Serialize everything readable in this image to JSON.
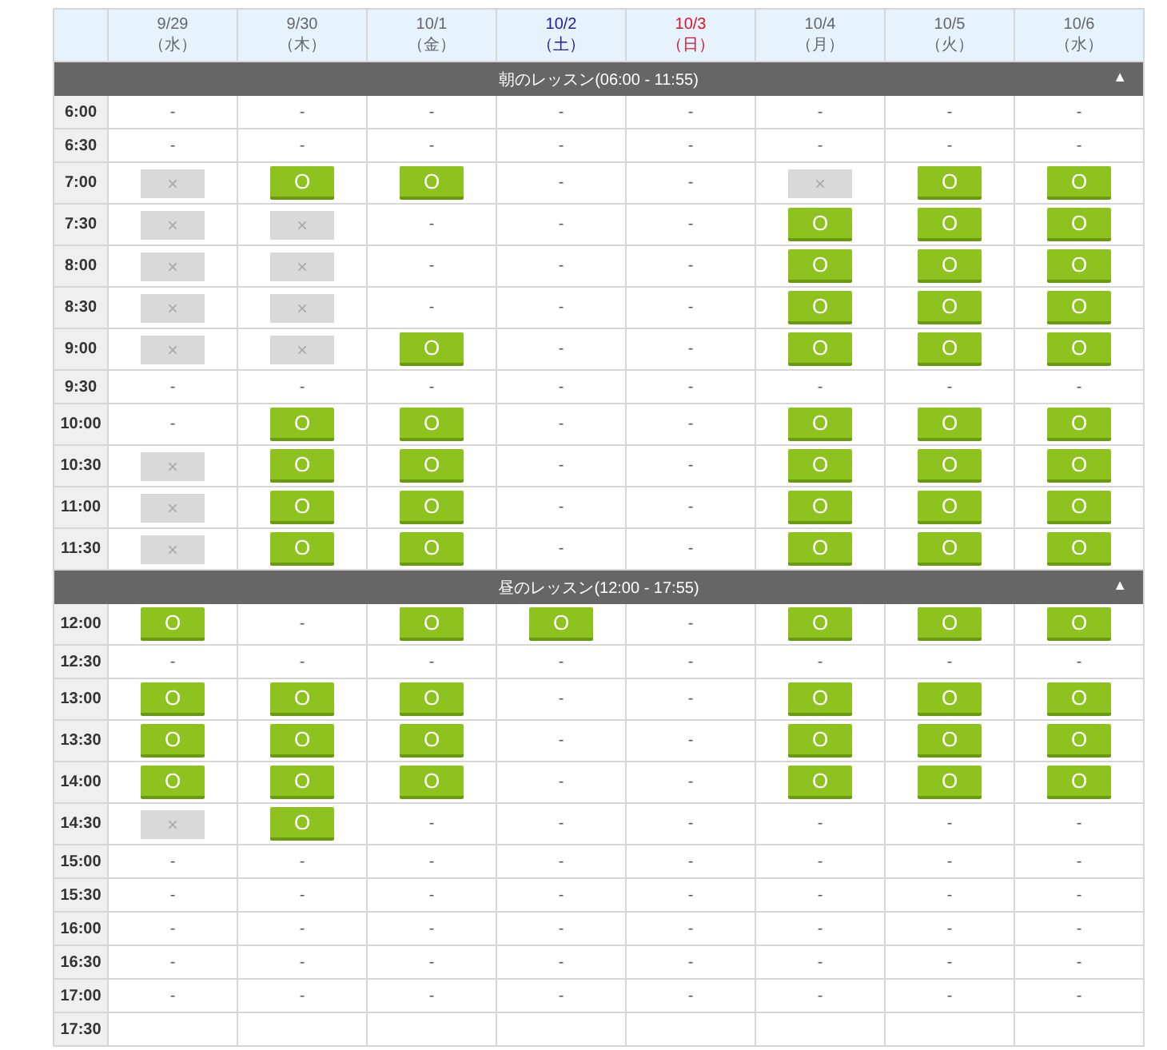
{
  "days": [
    {
      "date": "9/29",
      "weekday": "（水）",
      "color": "#666666"
    },
    {
      "date": "9/30",
      "weekday": "（木）",
      "color": "#666666"
    },
    {
      "date": "10/1",
      "weekday": "（金）",
      "color": "#666666"
    },
    {
      "date": "10/2",
      "weekday": "（土）",
      "color": "#1a1aa6"
    },
    {
      "date": "10/3",
      "weekday": "（日）",
      "color": "#e0102a"
    },
    {
      "date": "10/4",
      "weekday": "（月）",
      "color": "#666666"
    },
    {
      "date": "10/5",
      "weekday": "（火）",
      "color": "#666666"
    },
    {
      "date": "10/6",
      "weekday": "（水）",
      "color": "#666666"
    }
  ],
  "sections": [
    {
      "title": "朝のレッスン(06:00 - 11:55)",
      "toggle": "▲",
      "rows": [
        {
          "time": "6:00",
          "cells": [
            {
              "kind": "none",
              "text": "-"
            },
            {
              "kind": "none",
              "text": "-"
            },
            {
              "kind": "none",
              "text": "-"
            },
            {
              "kind": "none",
              "text": "-"
            },
            {
              "kind": "none",
              "text": "-"
            },
            {
              "kind": "none",
              "text": "-"
            },
            {
              "kind": "none",
              "text": "-"
            },
            {
              "kind": "none",
              "text": "-"
            }
          ]
        },
        {
          "time": "6:30",
          "cells": [
            {
              "kind": "none",
              "text": "-"
            },
            {
              "kind": "none",
              "text": "-"
            },
            {
              "kind": "none",
              "text": "-"
            },
            {
              "kind": "none",
              "text": "-"
            },
            {
              "kind": "none",
              "text": "-"
            },
            {
              "kind": "none",
              "text": "-"
            },
            {
              "kind": "none",
              "text": "-"
            },
            {
              "kind": "none",
              "text": "-"
            }
          ]
        },
        {
          "time": "7:00",
          "cells": [
            {
              "kind": "closed",
              "text": "×"
            },
            {
              "kind": "open",
              "text": "O"
            },
            {
              "kind": "open",
              "text": "O"
            },
            {
              "kind": "none",
              "text": "-"
            },
            {
              "kind": "none",
              "text": "-"
            },
            {
              "kind": "closed",
              "text": "×"
            },
            {
              "kind": "open",
              "text": "O"
            },
            {
              "kind": "open",
              "text": "O"
            }
          ]
        },
        {
          "time": "7:30",
          "cells": [
            {
              "kind": "closed",
              "text": "×"
            },
            {
              "kind": "closed",
              "text": "×"
            },
            {
              "kind": "none",
              "text": "-"
            },
            {
              "kind": "none",
              "text": "-"
            },
            {
              "kind": "none",
              "text": "-"
            },
            {
              "kind": "open",
              "text": "O"
            },
            {
              "kind": "open",
              "text": "O"
            },
            {
              "kind": "open",
              "text": "O"
            }
          ]
        },
        {
          "time": "8:00",
          "cells": [
            {
              "kind": "closed",
              "text": "×"
            },
            {
              "kind": "closed",
              "text": "×"
            },
            {
              "kind": "none",
              "text": "-"
            },
            {
              "kind": "none",
              "text": "-"
            },
            {
              "kind": "none",
              "text": "-"
            },
            {
              "kind": "open",
              "text": "O"
            },
            {
              "kind": "open",
              "text": "O"
            },
            {
              "kind": "open",
              "text": "O"
            }
          ]
        },
        {
          "time": "8:30",
          "cells": [
            {
              "kind": "closed",
              "text": "×"
            },
            {
              "kind": "closed",
              "text": "×"
            },
            {
              "kind": "none",
              "text": "-"
            },
            {
              "kind": "none",
              "text": "-"
            },
            {
              "kind": "none",
              "text": "-"
            },
            {
              "kind": "open",
              "text": "O"
            },
            {
              "kind": "open",
              "text": "O"
            },
            {
              "kind": "open",
              "text": "O"
            }
          ]
        },
        {
          "time": "9:00",
          "cells": [
            {
              "kind": "closed",
              "text": "×"
            },
            {
              "kind": "closed",
              "text": "×"
            },
            {
              "kind": "open",
              "text": "O"
            },
            {
              "kind": "none",
              "text": "-"
            },
            {
              "kind": "none",
              "text": "-"
            },
            {
              "kind": "open",
              "text": "O"
            },
            {
              "kind": "open",
              "text": "O"
            },
            {
              "kind": "open",
              "text": "O"
            }
          ]
        },
        {
          "time": "9:30",
          "cells": [
            {
              "kind": "none",
              "text": "-"
            },
            {
              "kind": "none",
              "text": "-"
            },
            {
              "kind": "none",
              "text": "-"
            },
            {
              "kind": "none",
              "text": "-"
            },
            {
              "kind": "none",
              "text": "-"
            },
            {
              "kind": "none",
              "text": "-"
            },
            {
              "kind": "none",
              "text": "-"
            },
            {
              "kind": "none",
              "text": "-"
            }
          ]
        },
        {
          "time": "10:00",
          "cells": [
            {
              "kind": "none",
              "text": "-"
            },
            {
              "kind": "open",
              "text": "O"
            },
            {
              "kind": "open",
              "text": "O"
            },
            {
              "kind": "none",
              "text": "-"
            },
            {
              "kind": "none",
              "text": "-"
            },
            {
              "kind": "open",
              "text": "O"
            },
            {
              "kind": "open",
              "text": "O"
            },
            {
              "kind": "open",
              "text": "O"
            }
          ]
        },
        {
          "time": "10:30",
          "cells": [
            {
              "kind": "closed",
              "text": "×"
            },
            {
              "kind": "open",
              "text": "O"
            },
            {
              "kind": "open",
              "text": "O"
            },
            {
              "kind": "none",
              "text": "-"
            },
            {
              "kind": "none",
              "text": "-"
            },
            {
              "kind": "open",
              "text": "O"
            },
            {
              "kind": "open",
              "text": "O"
            },
            {
              "kind": "open",
              "text": "O"
            }
          ]
        },
        {
          "time": "11:00",
          "cells": [
            {
              "kind": "closed",
              "text": "×"
            },
            {
              "kind": "open",
              "text": "O"
            },
            {
              "kind": "open",
              "text": "O"
            },
            {
              "kind": "none",
              "text": "-"
            },
            {
              "kind": "none",
              "text": "-"
            },
            {
              "kind": "open",
              "text": "O"
            },
            {
              "kind": "open",
              "text": "O"
            },
            {
              "kind": "open",
              "text": "O"
            }
          ]
        },
        {
          "time": "11:30",
          "cells": [
            {
              "kind": "closed",
              "text": "×"
            },
            {
              "kind": "open",
              "text": "O"
            },
            {
              "kind": "open",
              "text": "O"
            },
            {
              "kind": "none",
              "text": "-"
            },
            {
              "kind": "none",
              "text": "-"
            },
            {
              "kind": "open",
              "text": "O"
            },
            {
              "kind": "open",
              "text": "O"
            },
            {
              "kind": "open",
              "text": "O"
            }
          ]
        }
      ]
    },
    {
      "title": "昼のレッスン(12:00 - 17:55)",
      "toggle": "▲",
      "rows": [
        {
          "time": "12:00",
          "cells": [
            {
              "kind": "open",
              "text": "O"
            },
            {
              "kind": "none",
              "text": "-"
            },
            {
              "kind": "open",
              "text": "O"
            },
            {
              "kind": "open",
              "text": "O"
            },
            {
              "kind": "none",
              "text": "-"
            },
            {
              "kind": "open",
              "text": "O"
            },
            {
              "kind": "open",
              "text": "O"
            },
            {
              "kind": "open",
              "text": "O"
            }
          ]
        },
        {
          "time": "12:30",
          "cells": [
            {
              "kind": "none",
              "text": "-"
            },
            {
              "kind": "none",
              "text": "-"
            },
            {
              "kind": "none",
              "text": "-"
            },
            {
              "kind": "none",
              "text": "-"
            },
            {
              "kind": "none",
              "text": "-"
            },
            {
              "kind": "none",
              "text": "-"
            },
            {
              "kind": "none",
              "text": "-"
            },
            {
              "kind": "none",
              "text": "-"
            }
          ]
        },
        {
          "time": "13:00",
          "cells": [
            {
              "kind": "open",
              "text": "O"
            },
            {
              "kind": "open",
              "text": "O"
            },
            {
              "kind": "open",
              "text": "O"
            },
            {
              "kind": "none",
              "text": "-"
            },
            {
              "kind": "none",
              "text": "-"
            },
            {
              "kind": "open",
              "text": "O"
            },
            {
              "kind": "open",
              "text": "O"
            },
            {
              "kind": "open",
              "text": "O"
            }
          ]
        },
        {
          "time": "13:30",
          "cells": [
            {
              "kind": "open",
              "text": "O"
            },
            {
              "kind": "open",
              "text": "O"
            },
            {
              "kind": "open",
              "text": "O"
            },
            {
              "kind": "none",
              "text": "-"
            },
            {
              "kind": "none",
              "text": "-"
            },
            {
              "kind": "open",
              "text": "O"
            },
            {
              "kind": "open",
              "text": "O"
            },
            {
              "kind": "open",
              "text": "O"
            }
          ]
        },
        {
          "time": "14:00",
          "cells": [
            {
              "kind": "open",
              "text": "O"
            },
            {
              "kind": "open",
              "text": "O"
            },
            {
              "kind": "open",
              "text": "O"
            },
            {
              "kind": "none",
              "text": "-"
            },
            {
              "kind": "none",
              "text": "-"
            },
            {
              "kind": "open",
              "text": "O"
            },
            {
              "kind": "open",
              "text": "O"
            },
            {
              "kind": "open",
              "text": "O"
            }
          ]
        },
        {
          "time": "14:30",
          "cells": [
            {
              "kind": "closed",
              "text": "×"
            },
            {
              "kind": "open",
              "text": "O"
            },
            {
              "kind": "none",
              "text": "-"
            },
            {
              "kind": "none",
              "text": "-"
            },
            {
              "kind": "none",
              "text": "-"
            },
            {
              "kind": "none",
              "text": "-"
            },
            {
              "kind": "none",
              "text": "-"
            },
            {
              "kind": "none",
              "text": "-"
            }
          ]
        },
        {
          "time": "15:00",
          "cells": [
            {
              "kind": "none",
              "text": "-"
            },
            {
              "kind": "none",
              "text": "-"
            },
            {
              "kind": "none",
              "text": "-"
            },
            {
              "kind": "none",
              "text": "-"
            },
            {
              "kind": "none",
              "text": "-"
            },
            {
              "kind": "none",
              "text": "-"
            },
            {
              "kind": "none",
              "text": "-"
            },
            {
              "kind": "none",
              "text": "-"
            }
          ]
        },
        {
          "time": "15:30",
          "cells": [
            {
              "kind": "none",
              "text": "-"
            },
            {
              "kind": "none",
              "text": "-"
            },
            {
              "kind": "none",
              "text": "-"
            },
            {
              "kind": "none",
              "text": "-"
            },
            {
              "kind": "none",
              "text": "-"
            },
            {
              "kind": "none",
              "text": "-"
            },
            {
              "kind": "none",
              "text": "-"
            },
            {
              "kind": "none",
              "text": "-"
            }
          ]
        },
        {
          "time": "16:00",
          "cells": [
            {
              "kind": "none",
              "text": "-"
            },
            {
              "kind": "none",
              "text": "-"
            },
            {
              "kind": "none",
              "text": "-"
            },
            {
              "kind": "none",
              "text": "-"
            },
            {
              "kind": "none",
              "text": "-"
            },
            {
              "kind": "none",
              "text": "-"
            },
            {
              "kind": "none",
              "text": "-"
            },
            {
              "kind": "none",
              "text": "-"
            }
          ]
        },
        {
          "time": "16:30",
          "cells": [
            {
              "kind": "none",
              "text": "-"
            },
            {
              "kind": "none",
              "text": "-"
            },
            {
              "kind": "none",
              "text": "-"
            },
            {
              "kind": "none",
              "text": "-"
            },
            {
              "kind": "none",
              "text": "-"
            },
            {
              "kind": "none",
              "text": "-"
            },
            {
              "kind": "none",
              "text": "-"
            },
            {
              "kind": "none",
              "text": "-"
            }
          ]
        },
        {
          "time": "17:00",
          "cells": [
            {
              "kind": "none",
              "text": "-"
            },
            {
              "kind": "none",
              "text": "-"
            },
            {
              "kind": "none",
              "text": "-"
            },
            {
              "kind": "none",
              "text": "-"
            },
            {
              "kind": "none",
              "text": "-"
            },
            {
              "kind": "none",
              "text": "-"
            },
            {
              "kind": "none",
              "text": "-"
            },
            {
              "kind": "none",
              "text": "-"
            }
          ]
        },
        {
          "time": "17:30"
        }
      ]
    }
  ]
}
